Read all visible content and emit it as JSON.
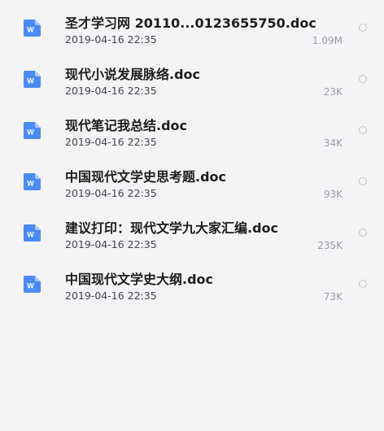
{
  "files": [
    {
      "icon": "word-doc-icon",
      "icon_letter": "W",
      "name": "圣才学习网 20110...0123655750.doc",
      "date": "2019-04-16 22:35",
      "size": "1.09M"
    },
    {
      "icon": "word-doc-icon",
      "icon_letter": "W",
      "name": "现代小说发展脉络.doc",
      "date": "2019-04-16 22:35",
      "size": "23K"
    },
    {
      "icon": "word-doc-icon",
      "icon_letter": "W",
      "name": "现代笔记我总结.doc",
      "date": "2019-04-16 22:35",
      "size": "34K"
    },
    {
      "icon": "word-doc-icon",
      "icon_letter": "W",
      "name": "中国现代文学史思考题.doc",
      "date": "2019-04-16 22:35",
      "size": "93K"
    },
    {
      "icon": "word-doc-icon",
      "icon_letter": "W",
      "name": "建议打印：现代文学九大家汇编.doc",
      "date": "2019-04-16 22:35",
      "size": "235K"
    },
    {
      "icon": "word-doc-icon",
      "icon_letter": "W",
      "name": "中国现代文学史大纲.doc",
      "date": "2019-04-16 22:35",
      "size": "73K"
    }
  ],
  "colors": {
    "background": "#f4f4f6",
    "icon_blue": "#4a8af4",
    "icon_fold": "#a9c8fa",
    "name_text": "#1d1d1f",
    "date_text": "#45454a",
    "size_text": "#9a9aa0",
    "radio_border": "#c4c4c8"
  }
}
